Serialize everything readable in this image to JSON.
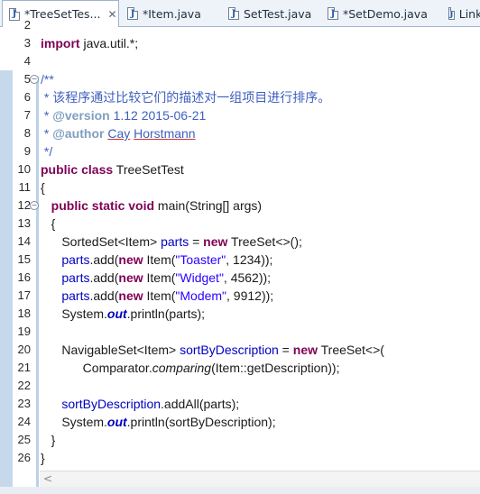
{
  "tabs": [
    {
      "label": "*TreeSetTes...",
      "icon": "java-file-icon",
      "active": true,
      "close": "✕"
    },
    {
      "label": "*Item.java",
      "icon": "java-file-icon",
      "active": false
    },
    {
      "label": "SetTest.java",
      "icon": "java-file-icon",
      "active": false
    },
    {
      "label": "*SetDemo.java",
      "icon": "java-file-icon",
      "active": false
    },
    {
      "label": "Link",
      "icon": "java-file-icon",
      "active": false
    }
  ],
  "editor": {
    "lines": [
      {
        "n": "2",
        "html": ""
      },
      {
        "n": "3",
        "html": "<span class='kw'>import</span> java.util.*;"
      },
      {
        "n": "4",
        "html": ""
      },
      {
        "n": "5",
        "html": "<span class='cm'>/**</span>"
      },
      {
        "n": "6",
        "html": "<span class='cm'> * 该程序通过比较它们的描述对一组项目进行排序。</span>"
      },
      {
        "n": "7",
        "html": "<span class='cm'> * </span><span class='ct'>@version</span><span class='cm'> 1.12 2015-06-21</span>"
      },
      {
        "n": "8",
        "html": "<span class='cm'> * </span><span class='ct'>@author</span><span class='cm'> <span class='ul'>Cay</span> <span class='ul'>Horstmann</span></span>"
      },
      {
        "n": "9",
        "html": "<span class='cm'> */</span>"
      },
      {
        "n": "10",
        "html": "<span class='kw'>public</span> <span class='kw'>class</span> TreeSetTest"
      },
      {
        "n": "11",
        "html": "{"
      },
      {
        "n": "12",
        "html": "   <span class='kw'>public</span> <span class='kw'>static</span> <span class='kw'>void</span> main(String[] args)"
      },
      {
        "n": "13",
        "html": "   {"
      },
      {
        "n": "14",
        "html": "      SortedSet&lt;Item&gt; <span class='fld'>parts</span> = <span class='kw'>new</span> TreeSet&lt;&gt;();"
      },
      {
        "n": "15",
        "html": "      <span class='fld'>parts</span>.add(<span class='kw'>new</span> Item(<span class='str'>\"Toaster\"</span>, 1234));"
      },
      {
        "n": "16",
        "html": "      <span class='fld'>parts</span>.add(<span class='kw'>new</span> Item(<span class='str'>\"Widget\"</span>, 4562));"
      },
      {
        "n": "17",
        "html": "      <span class='fld'>parts</span>.add(<span class='kw'>new</span> Item(<span class='str'>\"Modem\"</span>, 9912));"
      },
      {
        "n": "18",
        "html": "      System.<span class='st'>out</span>.println(parts);"
      },
      {
        "n": "19",
        "html": ""
      },
      {
        "n": "20",
        "html": "      NavigableSet&lt;Item&gt; <span class='fld'>sortByDescription</span> = <span class='kw'>new</span> TreeSet&lt;&gt;("
      },
      {
        "n": "21",
        "html": "            Comparator.<span class='it'>comparing</span>(Item::getDescription));"
      },
      {
        "n": "22",
        "html": ""
      },
      {
        "n": "23",
        "html": "      <span class='fld'>sortByDescription</span>.addAll(parts);"
      },
      {
        "n": "24",
        "html": "      System.<span class='st'>out</span>.println(sortByDescription);"
      },
      {
        "n": "25",
        "html": "   }"
      },
      {
        "n": "26",
        "html": "}"
      }
    ]
  },
  "scrollbar": {
    "left_arrow": "<"
  }
}
